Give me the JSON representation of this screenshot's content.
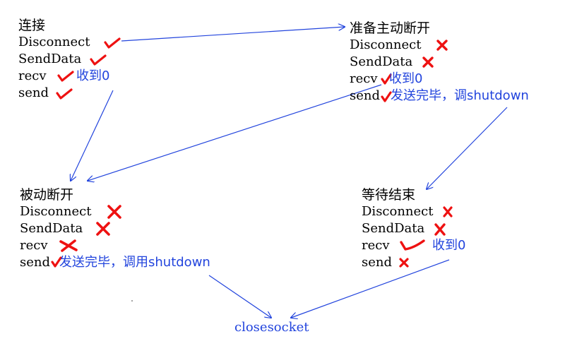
{
  "states": {
    "connected": {
      "title": "连接",
      "rows": [
        "Disconnect",
        "SendData",
        "recv",
        "send"
      ],
      "marks": [
        "check",
        "check",
        "check",
        "check"
      ],
      "notes": [
        "",
        "",
        "收到0",
        ""
      ]
    },
    "active_close": {
      "title": "准备主动断开",
      "rows": [
        "Disconnect",
        "SendData",
        "recv",
        "send"
      ],
      "marks": [
        "cross",
        "cross",
        "check",
        "check"
      ],
      "notes": [
        "",
        "",
        "收到0",
        "发送完毕，调shutdown"
      ]
    },
    "passive_close": {
      "title": "被动断开",
      "rows": [
        "Disconnect",
        "SendData",
        "recv",
        "send"
      ],
      "marks": [
        "cross",
        "cross",
        "cross",
        "check"
      ],
      "notes": [
        "",
        "",
        "",
        "发送完毕，调用shutdown"
      ]
    },
    "wait_end": {
      "title": "等待结束",
      "rows": [
        "Disconnect",
        "SendData",
        "recv",
        "send"
      ],
      "marks": [
        "cross",
        "cross",
        "check",
        "cross"
      ],
      "notes": [
        "",
        "",
        "收到0",
        ""
      ]
    }
  },
  "final": {
    "label": "closesocket"
  },
  "colors": {
    "text": "#000000",
    "mark": "#ee1111",
    "annotation": "#2244dd"
  }
}
